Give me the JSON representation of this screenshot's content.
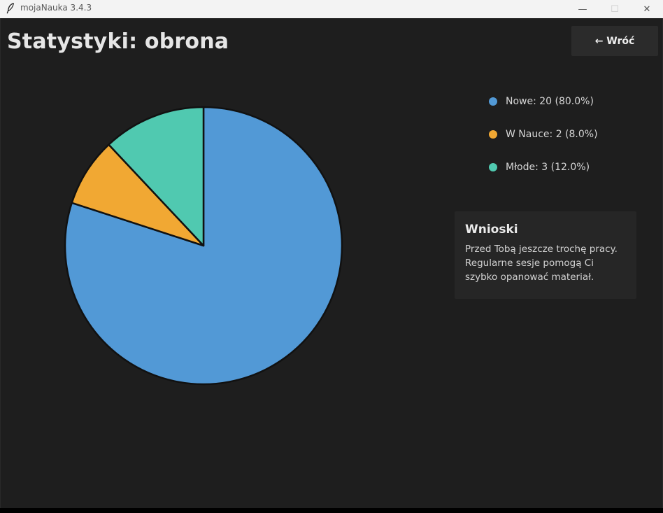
{
  "window": {
    "title": "mojaNauka 3.4.3",
    "icon": "feather-icon",
    "controls": {
      "minimize": "—",
      "maximize": "☐",
      "close": "✕"
    }
  },
  "header": {
    "title": "Statystyki: obrona",
    "back_label": "← Wróć"
  },
  "chart_data": {
    "type": "pie",
    "categories": [
      "Nowe",
      "W Nauce",
      "Młode"
    ],
    "values": [
      20,
      2,
      3
    ],
    "percentages": [
      80.0,
      8.0,
      12.0
    ],
    "colors": [
      "#5299d6",
      "#f1a833",
      "#50c9b0"
    ],
    "start_angle": "12 o'clock",
    "direction": "clockwise",
    "legend_placement": "right"
  },
  "legend": {
    "items": [
      {
        "label": "Nowe: 20 (80.0%)",
        "color": "#5299d6"
      },
      {
        "label": "W Nauce: 2 (8.0%)",
        "color": "#f1a833"
      },
      {
        "label": "Młode: 3 (12.0%)",
        "color": "#50c9b0"
      }
    ]
  },
  "insights": {
    "title": "Wnioski",
    "text": "Przed Tobą jeszcze trochę pracy. Regularne sesje pomogą Ci szybko opanować materiał."
  }
}
